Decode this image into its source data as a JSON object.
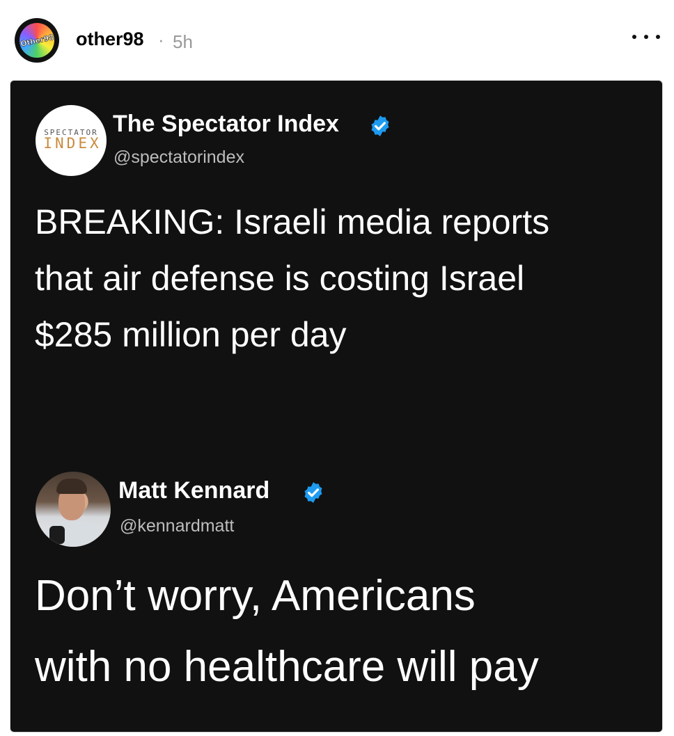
{
  "post": {
    "avatar_text": "Other98",
    "username": "other98",
    "separator": "·",
    "timestamp": "5h"
  },
  "card": {
    "tweet1": {
      "logo_top": "SPECTATOR",
      "logo_bottom": "INDEX",
      "display_name": "The Spectator Index",
      "handle": "@spectatorindex",
      "text_lines": [
        "BREAKING: Israeli media reports",
        "that air defense is costing Israel",
        "$285 million per day"
      ]
    },
    "tweet2": {
      "display_name": "Matt Kennard",
      "handle": "@kennardmatt",
      "text_lines": [
        "Don’t worry, Americans",
        "with no healthcare will pay"
      ]
    }
  },
  "colors": {
    "card_bg": "#111111",
    "verified_blue": "#1d9bf0",
    "handle_gray": "#bdbdbd",
    "timestamp_gray": "#999999"
  },
  "icons": {
    "more": "more-dots-icon",
    "verified": "verified-badge-icon"
  }
}
